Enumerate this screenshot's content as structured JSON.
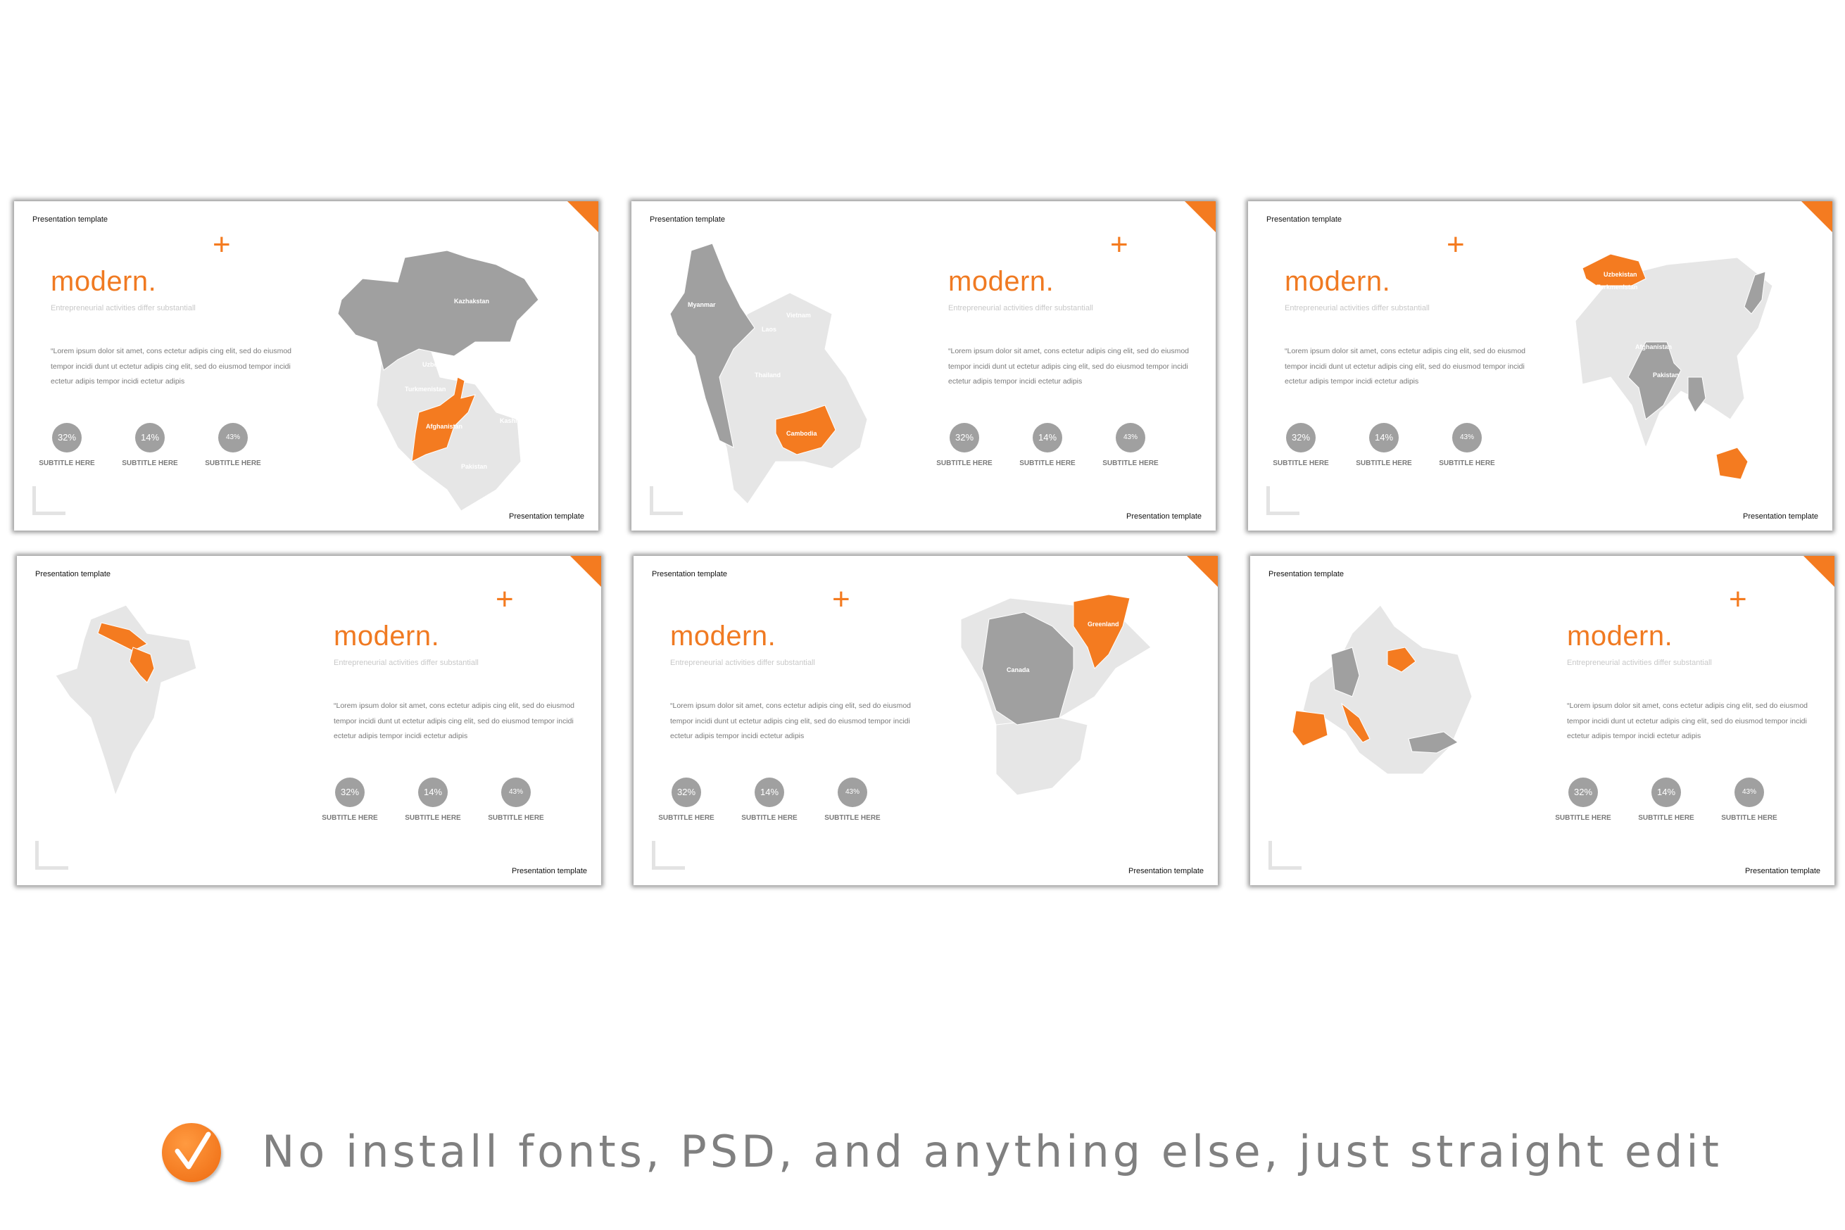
{
  "accent_color": "#f47b20",
  "highlight_gray": "#a0a0a0",
  "light_gray": "#e6e6e6",
  "slides": [
    {
      "header": "Presentation template",
      "footer": "Presentation template",
      "title": "modern.",
      "subtitle": "Entrepreneurial activities differ substantiall",
      "body": "“Lorem ipsum dolor sit amet, cons ectetur adipis cing elit, sed do eiusmod tempor incidi dunt ut ectetur adipis cing elit, sed do eiusmod tempor incidi ectetur adipis tempor incidi ectetur adipis",
      "stats": [
        {
          "value": "32%",
          "label": "SUBTITLE HERE"
        },
        {
          "value": "14%",
          "label": "SUBTITLE HERE"
        },
        {
          "value": "43%",
          "label": "SUBTITLE HERE"
        }
      ],
      "map_labels": [
        "Kazhakstan",
        "Uzbekistan",
        "Turkmenistan",
        "Afghanistan",
        "Kashmir",
        "Pakistan"
      ]
    },
    {
      "header": "Presentation template",
      "footer": "Presentation template",
      "title": "modern.",
      "subtitle": "Entrepreneurial activities differ substantiall",
      "body": "“Lorem ipsum dolor sit amet, cons ectetur adipis cing elit, sed do eiusmod tempor incidi dunt ut ectetur adipis cing elit, sed do eiusmod tempor incidi ectetur adipis tempor incidi ectetur adipis",
      "stats": [
        {
          "value": "32%",
          "label": "SUBTITLE HERE"
        },
        {
          "value": "14%",
          "label": "SUBTITLE HERE"
        },
        {
          "value": "43%",
          "label": "SUBTITLE HERE"
        }
      ],
      "map_labels": [
        "Myanmar",
        "Vietnam",
        "Laos",
        "Thailand",
        "Cambodia"
      ]
    },
    {
      "header": "Presentation template",
      "footer": "Presentation template",
      "title": "modern.",
      "subtitle": "Entrepreneurial activities differ substantiall",
      "body": "“Lorem ipsum dolor sit amet, cons ectetur adipis cing elit, sed do eiusmod tempor incidi dunt ut ectetur adipis cing elit, sed do eiusmod tempor incidi ectetur adipis tempor incidi ectetur adipis",
      "stats": [
        {
          "value": "32%",
          "label": "SUBTITLE HERE"
        },
        {
          "value": "14%",
          "label": "SUBTITLE HERE"
        },
        {
          "value": "43%",
          "label": "SUBTITLE HERE"
        }
      ],
      "map_labels": [
        "Uzbekistan",
        "Turkmenistan",
        "Afghanistan",
        "Pakistan"
      ]
    },
    {
      "header": "Presentation template",
      "footer": "Presentation template",
      "title": "modern.",
      "subtitle": "Entrepreneurial activities differ substantiall",
      "body": "“Lorem ipsum dolor sit amet, cons ectetur adipis cing elit, sed do eiusmod tempor incidi dunt ut ectetur adipis cing elit, sed do eiusmod tempor incidi ectetur adipis tempor incidi ectetur adipis",
      "stats": [
        {
          "value": "32%",
          "label": "SUBTITLE HERE"
        },
        {
          "value": "14%",
          "label": "SUBTITLE HERE"
        },
        {
          "value": "43%",
          "label": "SUBTITLE HERE"
        }
      ],
      "map_labels": []
    },
    {
      "header": "Presentation template",
      "footer": "Presentation template",
      "title": "modern.",
      "subtitle": "Entrepreneurial activities differ substantiall",
      "body": "“Lorem ipsum dolor sit amet, cons ectetur adipis cing elit, sed do eiusmod tempor incidi dunt ut ectetur adipis cing elit, sed do eiusmod tempor incidi ectetur adipis tempor incidi ectetur adipis",
      "stats": [
        {
          "value": "32%",
          "label": "SUBTITLE HERE"
        },
        {
          "value": "14%",
          "label": "SUBTITLE HERE"
        },
        {
          "value": "43%",
          "label": "SUBTITLE HERE"
        }
      ],
      "map_labels": [
        "Canada",
        "Greenland"
      ]
    },
    {
      "header": "Presentation template",
      "footer": "Presentation template",
      "title": "modern.",
      "subtitle": "Entrepreneurial activities differ substantiall",
      "body": "“Lorem ipsum dolor sit amet, cons ectetur adipis cing elit, sed do eiusmod tempor incidi dunt ut ectetur adipis cing elit, sed do eiusmod tempor incidi ectetur adipis tempor incidi ectetur adipis",
      "stats": [
        {
          "value": "32%",
          "label": "SUBTITLE HERE"
        },
        {
          "value": "14%",
          "label": "SUBTITLE HERE"
        },
        {
          "value": "43%",
          "label": "SUBTITLE HERE"
        }
      ],
      "map_labels": []
    }
  ],
  "banner": {
    "icon": "check-circle-icon",
    "text": "No install fonts, PSD, and anything else, just straight edit"
  }
}
